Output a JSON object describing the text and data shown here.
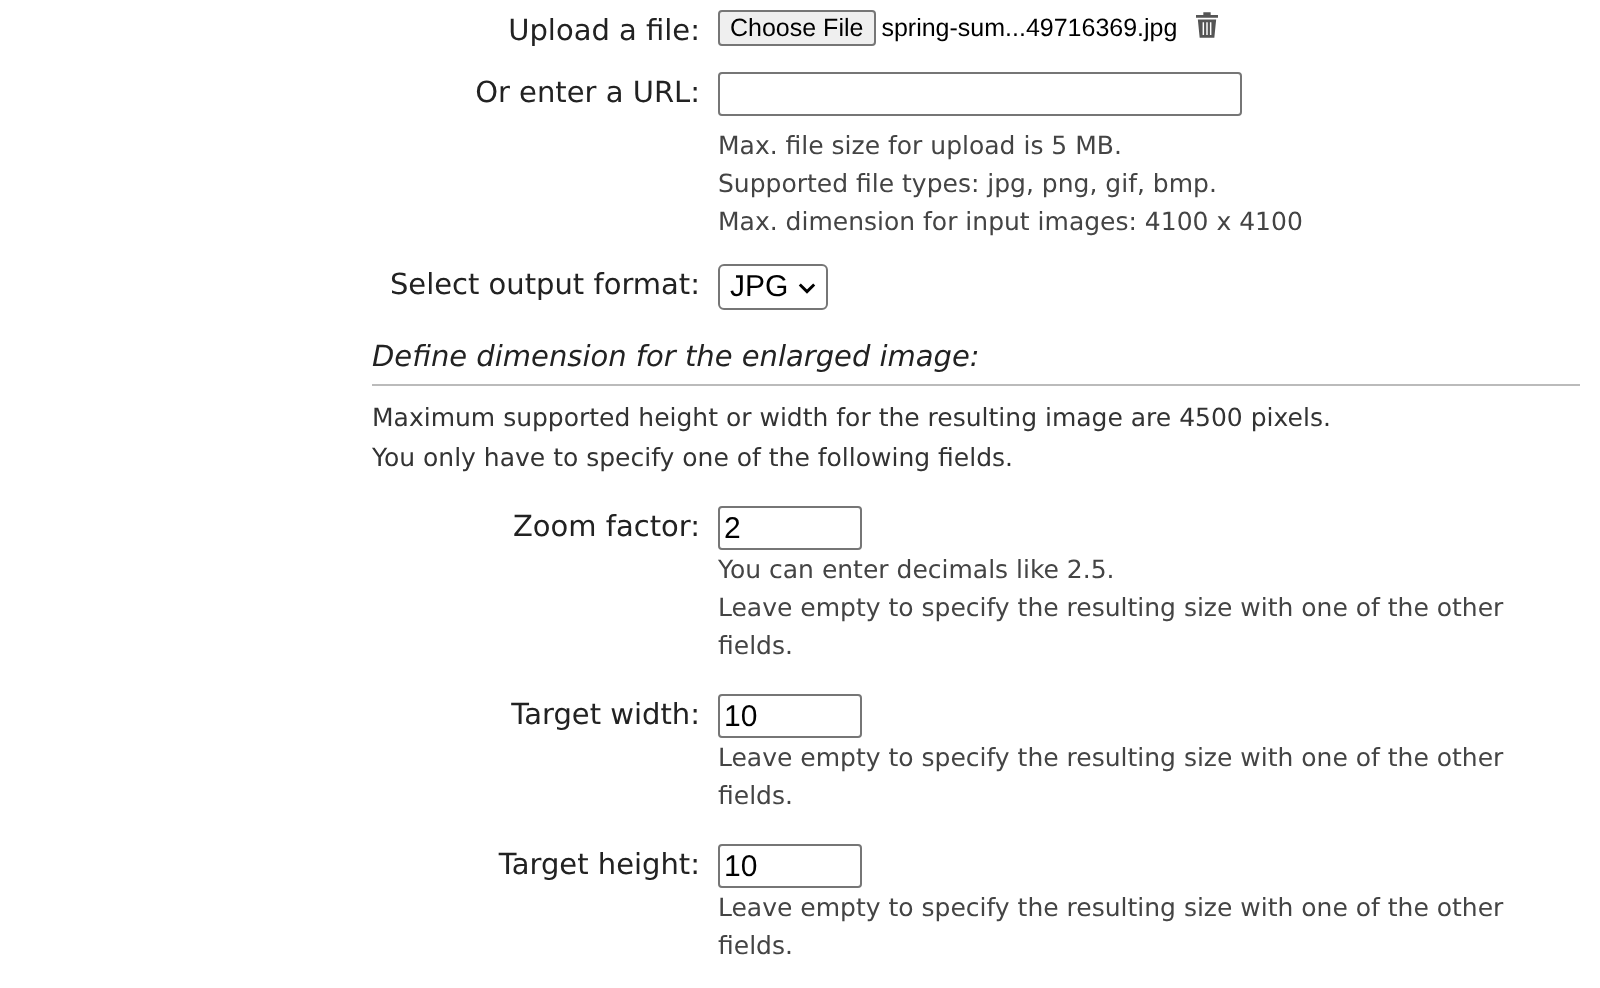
{
  "upload": {
    "label": "Upload a file:",
    "button": "Choose File",
    "filename": "spring-sum...49716369.jpg"
  },
  "url": {
    "label": "Or enter a URL:",
    "hints": [
      "Max. file size for upload is 5 MB.",
      "Supported file types: jpg, png, gif, bmp.",
      "Max. dimension for input images: 4100 x 4100"
    ]
  },
  "format": {
    "label": "Select output format:",
    "value": "JPG"
  },
  "dimension": {
    "heading": "Define dimension for the enlarged image:",
    "notes": [
      "Maximum supported height or width for the resulting image are 4500 pixels.",
      "You only have to specify one of the following fields."
    ],
    "fields": [
      {
        "label": "Zoom factor:",
        "value": "2",
        "hints": [
          "You can enter decimals like 2.5.",
          "Leave empty to specify the resulting size with one of the other fields."
        ]
      },
      {
        "label": "Target width:",
        "value": "10",
        "hints": [
          "Leave empty to specify the resulting size with one of the other fields."
        ]
      },
      {
        "label": "Target height:",
        "value": "10",
        "hints": [
          "Leave empty to specify the resulting size with one of the other fields."
        ]
      }
    ]
  }
}
